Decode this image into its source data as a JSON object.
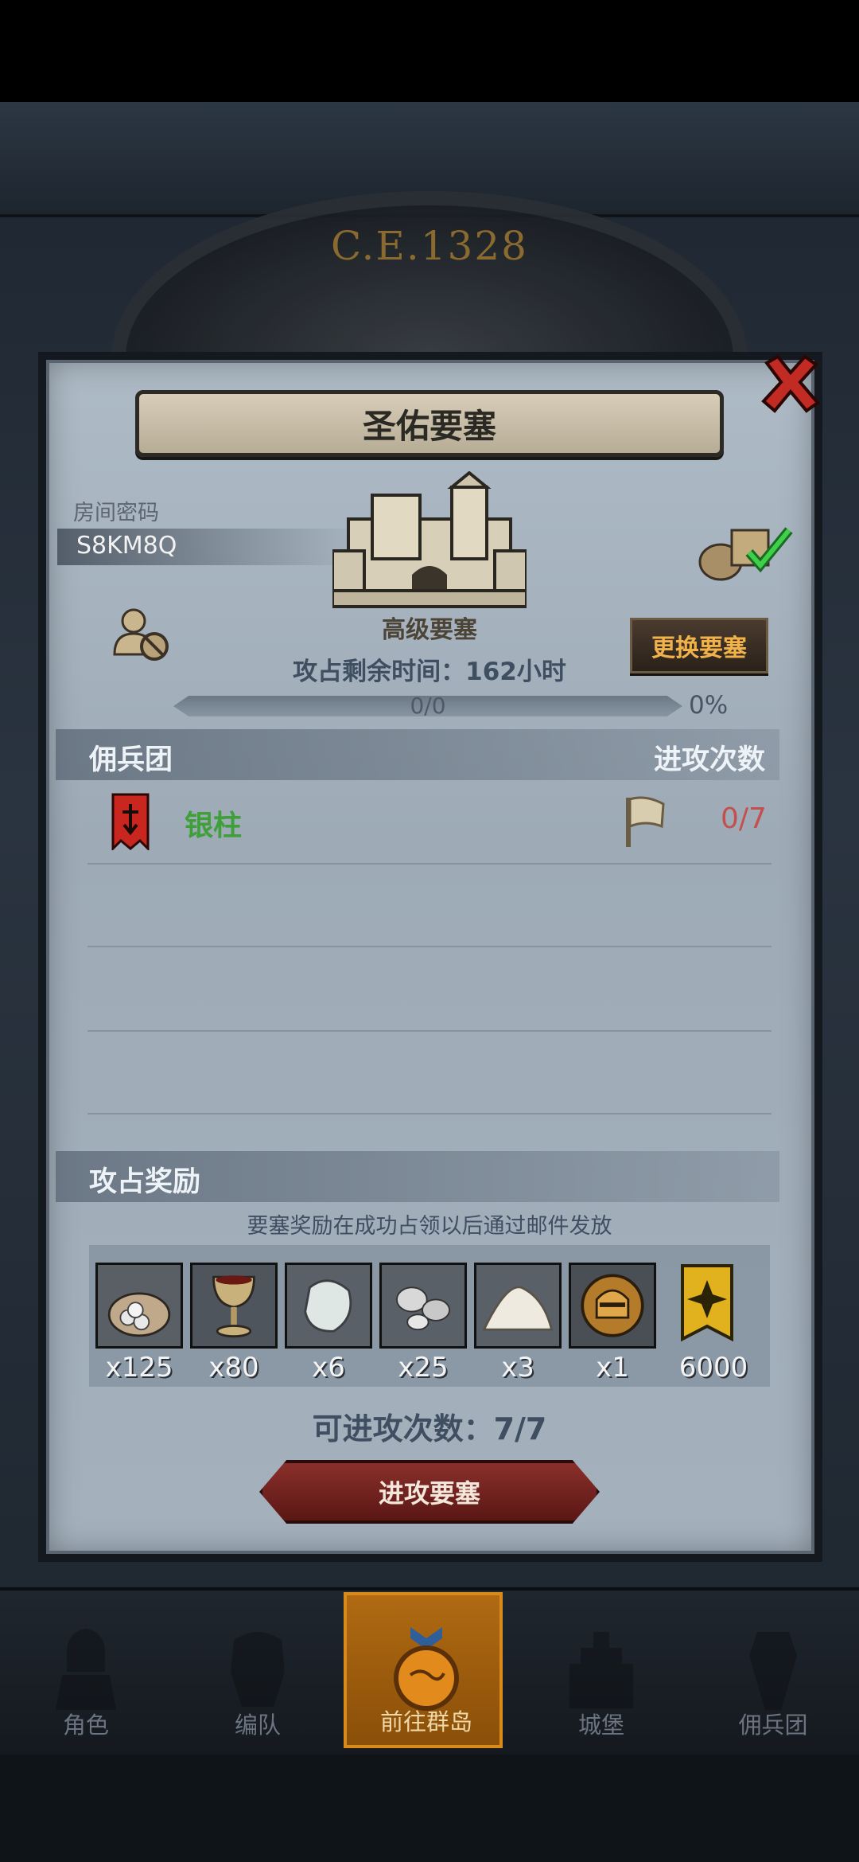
{
  "background": {
    "era_label": "C.E.1328"
  },
  "dialog": {
    "title": "圣佑要塞",
    "room_label": "房间密码",
    "room_code": "S8KM8Q",
    "fortress_level": "高级要塞",
    "time_left": "攻占剩余时间：162小时",
    "change_button": "更换要塞",
    "progress": {
      "text": "0/0",
      "percent_label": "0%",
      "fraction": 0
    },
    "mercenary_section": {
      "title": "佣兵团",
      "attacks_header": "进攻次数"
    },
    "mercenaries": [
      {
        "name": "银柱",
        "attacks": "0/7"
      }
    ],
    "reward_section": {
      "title": "攻占奖励",
      "note": "要塞奖励在成功占领以后通过邮件发放",
      "items": [
        {
          "icon": "silver-coin-sack-icon",
          "qty": "x125"
        },
        {
          "icon": "goblet-icon",
          "qty": "x80"
        },
        {
          "icon": "pearl-stone-icon",
          "qty": "x6"
        },
        {
          "icon": "silver-ore-icon",
          "qty": "x25"
        },
        {
          "icon": "salt-pile-icon",
          "qty": "x3"
        },
        {
          "icon": "knight-helmet-coin-icon",
          "qty": "x1"
        },
        {
          "icon": "rank-emblem-icon",
          "qty": "6000"
        }
      ]
    },
    "attacks_left": "可进攻次数：7/7",
    "attack_button": "进攻要塞"
  },
  "colors": {
    "accent_orange": "#f1b24a",
    "mercenary_green": "#3fa03a",
    "attack_count_red": "#c4504e",
    "attack_button_red": "#8a2f2b"
  },
  "bottom_nav": [
    {
      "label": "角色",
      "icon": "knight-icon",
      "active": false
    },
    {
      "label": "编队",
      "icon": "armor-squad-icon",
      "active": false
    },
    {
      "label": "前往群岛",
      "icon": "world-map-icon",
      "active": true
    },
    {
      "label": "城堡",
      "icon": "castle-icon",
      "active": false
    },
    {
      "label": "佣兵团",
      "icon": "mercenary-banner-icon",
      "active": false
    }
  ]
}
